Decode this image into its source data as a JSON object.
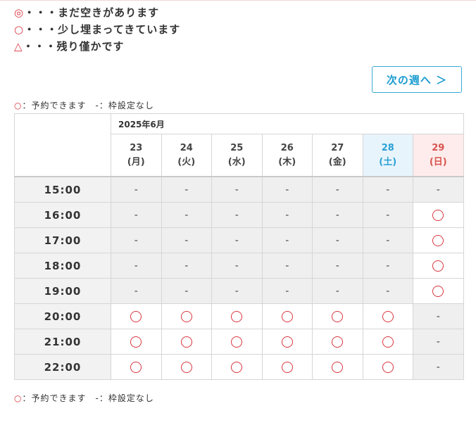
{
  "legend": [
    {
      "symbol": "◎",
      "text": "・・・まだ空きがあります"
    },
    {
      "symbol": "○",
      "text": "・・・少し埋まってきています"
    },
    {
      "symbol": "△",
      "text": "・・・残り僅かです"
    }
  ],
  "next_week_button": "次の週へ ＞",
  "key": {
    "circle": "○",
    "text": "：予約できます　-：枠設定なし"
  },
  "month_label": "2025年6月",
  "days": [
    {
      "date": "23",
      "weekday": "(月)",
      "type": "weekday"
    },
    {
      "date": "24",
      "weekday": "(火)",
      "type": "weekday"
    },
    {
      "date": "25",
      "weekday": "(水)",
      "type": "weekday"
    },
    {
      "date": "26",
      "weekday": "(木)",
      "type": "weekday"
    },
    {
      "date": "27",
      "weekday": "(金)",
      "type": "weekday"
    },
    {
      "date": "28",
      "weekday": "(土)",
      "type": "sat"
    },
    {
      "date": "29",
      "weekday": "(日)",
      "type": "sun"
    }
  ],
  "dash": "-",
  "rows": [
    {
      "time": "15:00",
      "slots": [
        "-",
        "-",
        "-",
        "-",
        "-",
        "-",
        "-"
      ]
    },
    {
      "time": "16:00",
      "slots": [
        "-",
        "-",
        "-",
        "-",
        "-",
        "-",
        "○"
      ]
    },
    {
      "time": "17:00",
      "slots": [
        "-",
        "-",
        "-",
        "-",
        "-",
        "-",
        "○"
      ]
    },
    {
      "time": "18:00",
      "slots": [
        "-",
        "-",
        "-",
        "-",
        "-",
        "-",
        "○"
      ]
    },
    {
      "time": "19:00",
      "slots": [
        "-",
        "-",
        "-",
        "-",
        "-",
        "-",
        "○"
      ]
    },
    {
      "time": "20:00",
      "slots": [
        "○",
        "○",
        "○",
        "○",
        "○",
        "○",
        "-"
      ]
    },
    {
      "time": "21:00",
      "slots": [
        "○",
        "○",
        "○",
        "○",
        "○",
        "○",
        "-"
      ]
    },
    {
      "time": "22:00",
      "slots": [
        "○",
        "○",
        "○",
        "○",
        "○",
        "○",
        "-"
      ]
    }
  ],
  "colors": {
    "accent": "#1a9bd0",
    "available": "#d9363e",
    "saturday": "#2aa0d4",
    "sunday": "#d9534f"
  }
}
